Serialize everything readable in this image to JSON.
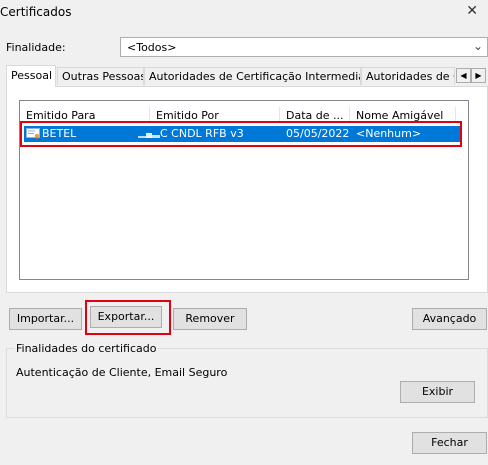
{
  "window": {
    "title": "Certificados"
  },
  "purpose": {
    "label": "Finalidade:",
    "value": "<Todos>"
  },
  "tabs": [
    {
      "label": "Pessoal"
    },
    {
      "label": "Outras Pessoas"
    },
    {
      "label": "Autoridades de Certificação Intermediárias"
    },
    {
      "label": "Autoridades de Ce"
    }
  ],
  "table": {
    "columns": [
      "Emitido Para",
      "Emitido Por",
      "Data de ...",
      "Nome Amigável"
    ],
    "rows": [
      {
        "issued_to": "BETEL",
        "issued_by": "C CNDL RFB v3",
        "date": "05/05/2022",
        "friendly_name": "<Nenhum>"
      }
    ]
  },
  "buttons": {
    "import": "Importar...",
    "export": "Exportar...",
    "remove": "Remover",
    "advanced": "Avançado",
    "view": "Exibir",
    "close": "Fechar"
  },
  "purposes_group": {
    "title": "Finalidades do certificado",
    "text": "Autenticação de Cliente, Email Seguro"
  },
  "colors": {
    "selection": "#0078d7",
    "highlight": "#e3000f"
  }
}
